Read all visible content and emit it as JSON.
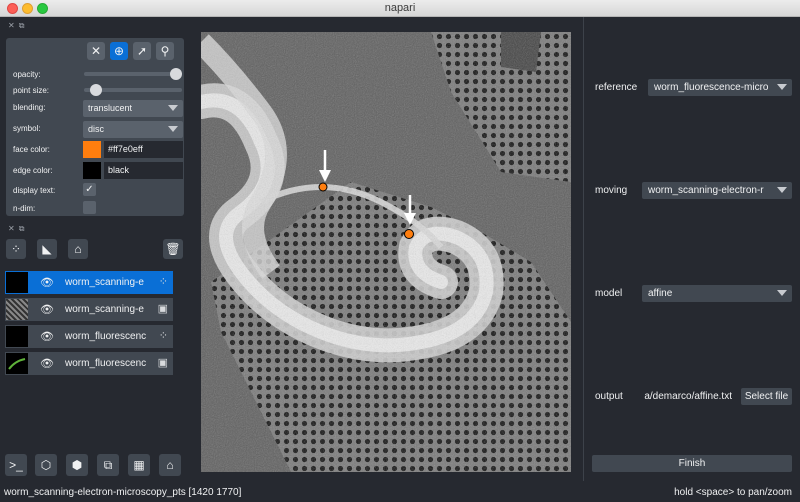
{
  "window": {
    "title": "napari"
  },
  "layer_controls": {
    "opacity_label": "opacity:",
    "opacity_value": 1.0,
    "point_size_label": "point size:",
    "point_size_value": 0.05,
    "blending_label": "blending:",
    "blending_value": "translucent",
    "symbol_label": "symbol:",
    "symbol_value": "disc",
    "face_color_label": "face color:",
    "face_color_value": "#ff7e0eff",
    "face_color_swatch": "#ff7e0e",
    "edge_color_label": "edge color:",
    "edge_color_value": "black",
    "edge_color_swatch": "#000000",
    "display_text_label": "display text:",
    "display_text_checked": "✓",
    "ndim_label": "n-dim:"
  },
  "layers": [
    {
      "name": "worm_scanning-e",
      "type": "points",
      "selected": true
    },
    {
      "name": "worm_scanning-e",
      "type": "image",
      "selected": false
    },
    {
      "name": "worm_fluorescenc",
      "type": "points",
      "selected": false
    },
    {
      "name": "worm_fluorescenc",
      "type": "image",
      "selected": false
    }
  ],
  "registration": {
    "reference_label": "reference",
    "reference_value": "worm_fluorescence-micro",
    "moving_label": "moving",
    "moving_value": "worm_scanning-electron-r",
    "model_label": "model",
    "model_value": "affine",
    "output_label": "output",
    "output_value": "a/demarco/affine.txt",
    "select_file_label": "Select file",
    "finish_label": "Finish"
  },
  "status": {
    "left": "worm_scanning-electron-microscopy_pts [1420 1770]",
    "right": "hold <space> to pan/zoom"
  },
  "colors": {
    "accent": "#0a6fd6",
    "panel": "#414851",
    "background": "#262930",
    "point": "#ff7e0e"
  }
}
